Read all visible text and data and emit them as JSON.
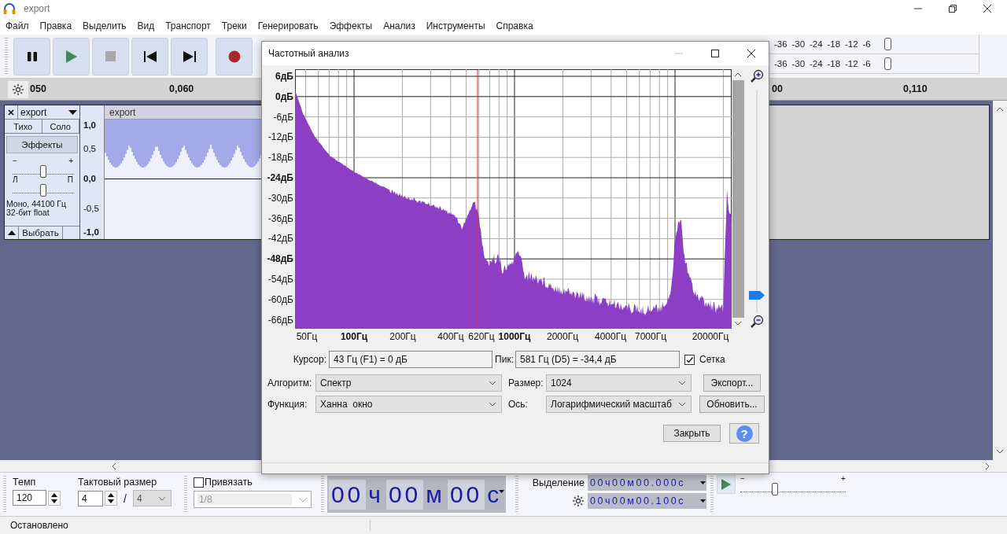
{
  "window": {
    "title": "export"
  },
  "menu": [
    "Файл",
    "Правка",
    "Выделить",
    "Вид",
    "Транспорт",
    "Треки",
    "Генерировать",
    "Эффекты",
    "Анализ",
    "Инструменты",
    "Справка"
  ],
  "meters": [
    {
      "scale": [
        "-36",
        "-30",
        "-24",
        "-18",
        "-12",
        "-6"
      ]
    },
    {
      "scale": [
        "-36",
        "-30",
        "-24",
        "-18",
        "-12",
        "-6"
      ]
    }
  ],
  "ruler": {
    "labels": [
      "050",
      "0,060",
      "00",
      "0,110"
    ]
  },
  "track": {
    "name": "export",
    "mute": "Тихо",
    "solo": "Соло",
    "effects": "Эффекты",
    "gain": {
      "min": "−",
      "max": "+",
      "level": 0.5
    },
    "pan": {
      "min": "Л",
      "max": "П",
      "level": 0.5
    },
    "info": [
      "Моно, 44100 Гц",
      "32-бит float"
    ],
    "select": "Выбрать",
    "scale": [
      "1,0",
      "0,5",
      "0,0",
      "-0,5",
      "-1,0"
    ],
    "clip_name": "export"
  },
  "dialog": {
    "title": "Частотный анализ",
    "y_labels": [
      {
        "text": "6дБ",
        "major": true
      },
      {
        "text": "0дБ",
        "major": true
      },
      {
        "text": "-6дБ",
        "major": false
      },
      {
        "text": "-12дБ",
        "major": false
      },
      {
        "text": "-18дБ",
        "major": false
      },
      {
        "text": "-24дБ",
        "major": true
      },
      {
        "text": "-30дБ",
        "major": false
      },
      {
        "text": "-36дБ",
        "major": false
      },
      {
        "text": "-42дБ",
        "major": false
      },
      {
        "text": "-48дБ",
        "major": true
      },
      {
        "text": "-54дБ",
        "major": false
      },
      {
        "text": "-60дБ",
        "major": false
      },
      {
        "text": "-66дБ",
        "major": false
      }
    ],
    "x_labels": [
      {
        "text": "50Гц",
        "major": false
      },
      {
        "text": "100Гц",
        "major": true
      },
      {
        "text": "200Гц",
        "major": false
      },
      {
        "text": "400Гц",
        "major": false
      },
      {
        "text": "620Гц",
        "major": false
      },
      {
        "text": "1000Гц",
        "major": true
      },
      {
        "text": "2000Гц",
        "major": false
      },
      {
        "text": "4000Гц",
        "major": false
      },
      {
        "text": "7000Гц",
        "major": false
      },
      {
        "text": "20000Гц",
        "major": false
      }
    ],
    "zoom": {
      "level": 0.06
    },
    "cursor": {
      "label": "Курсор:",
      "value": "43 Гц (F1) = 0 дБ"
    },
    "peak": {
      "label": "Пик:",
      "value": "581 Гц (D5) = -34,4 дБ"
    },
    "grid": {
      "label": "Сетка",
      "checked": true
    },
    "algorithm": {
      "label": "Алгоритм:",
      "value": "Спектр"
    },
    "size": {
      "label": "Размер:",
      "value": "1024"
    },
    "function": {
      "label": "Функция:",
      "value": "Ханна  окно"
    },
    "axis": {
      "label": "Ось:",
      "value": "Логарифмический масштаб"
    },
    "export_button": "Экспорт...",
    "refresh_button": "Обновить...",
    "close_button": "Закрыть",
    "help_button": "?"
  },
  "bottom": {
    "tempo": {
      "label": "Темп",
      "value": "120"
    },
    "time_signature": {
      "label": "Тактовый размер",
      "upper": "4",
      "slash": "/",
      "lower": "4"
    },
    "snap": {
      "label": "Привязать",
      "checked": false,
      "value": "1/8",
      "disabled": true
    },
    "time": [
      {
        "text": "00",
        "kind": "digits"
      },
      {
        "text": "ч",
        "kind": "unit"
      },
      {
        "text": "00",
        "kind": "digits"
      },
      {
        "text": "м",
        "kind": "unit"
      },
      {
        "text": "00",
        "kind": "digits"
      },
      {
        "text": "с",
        "kind": "unit"
      }
    ],
    "selection": {
      "label": "Выделение",
      "start": "00ч00м00.000с",
      "end": "00ч00м00.100с"
    },
    "play_speed": {
      "min": "−",
      "max": "+",
      "level": 0.33
    }
  },
  "status_bar": {
    "text": "Остановлено"
  }
}
